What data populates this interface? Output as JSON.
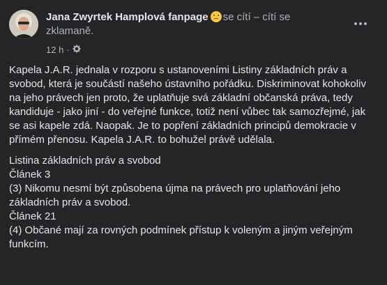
{
  "post": {
    "author": "Jana Zwyrtek Hamplová fanpage",
    "feeling_text": "se cítí – cítí se zklamaně.",
    "feeling_icon": "disappointed-face-emoji",
    "time": "12 h",
    "privacy_icon": "gear-icon",
    "more_icon": "more-options-icon",
    "paragraph": "Kapela J.A.R. jednala v rozporu s ustanoveními Listiny základních práv a svobod, která je součástí našeho ústavního pořádku. Diskriminovat kohokoliv na jeho právech jen proto, že uplatňuje svá základní občanská práva, tedy kandiduje - jako jiní - do veřejné funkce, totiž není vůbec tak samozřejmé, jak se asi kapele zdá. Naopak. Je to popření základních principů demokracie v přímém přenosu. Kapela J.A.R. to bohužel právě udělala.",
    "lines": [
      "Listina základních práv a svobod",
      "Článek 3",
      "(3) Nikomu nesmí být způsobena újma na právech pro uplatňování jeho základních práv a svobod.",
      "Článek 21",
      "(4) Občané mají za rovných podmínek přístup k voleným a jiným veřejným funkcím."
    ]
  }
}
